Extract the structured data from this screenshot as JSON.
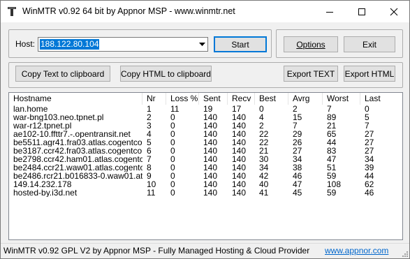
{
  "window": {
    "title": "WinMTR v0.92 64 bit by Appnor MSP - www.winmtr.net",
    "icon": "pliers-icon"
  },
  "host": {
    "label": "Host:",
    "value": "188.122.80.104",
    "start_label": "Start"
  },
  "options": {
    "options_label": "Options",
    "exit_label": "Exit"
  },
  "export": {
    "copy_text_label": "Copy Text to clipboard",
    "copy_html_label": "Copy HTML to clipboard",
    "export_text_label": "Export TEXT",
    "export_html_label": "Export HTML"
  },
  "table": {
    "columns": [
      "Hostname",
      "Nr",
      "Loss %",
      "Sent",
      "Recv",
      "Best",
      "Avrg",
      "Worst",
      "Last"
    ],
    "rows": [
      [
        "lan.home",
        "1",
        "11",
        "19",
        "17",
        "0",
        "2",
        "7",
        "0"
      ],
      [
        "war-bng103.neo.tpnet.pl",
        "2",
        "0",
        "140",
        "140",
        "4",
        "15",
        "89",
        "5"
      ],
      [
        "war-r12.tpnet.pl",
        "3",
        "0",
        "140",
        "140",
        "2",
        "7",
        "21",
        "7"
      ],
      [
        "ae102-10.ffttr7.-.opentransit.net",
        "4",
        "0",
        "140",
        "140",
        "22",
        "29",
        "65",
        "27"
      ],
      [
        "be5511.agr41.fra03.atlas.cogentco.c...",
        "5",
        "0",
        "140",
        "140",
        "22",
        "26",
        "44",
        "27"
      ],
      [
        "be3187.ccr42.fra03.atlas.cogentco.c...",
        "6",
        "0",
        "140",
        "140",
        "21",
        "27",
        "83",
        "27"
      ],
      [
        "be2798.ccr42.ham01.atlas.cogentco....",
        "7",
        "0",
        "140",
        "140",
        "30",
        "34",
        "47",
        "34"
      ],
      [
        "be2484.ccr21.waw01.atlas.cogentc...",
        "8",
        "0",
        "140",
        "140",
        "34",
        "38",
        "51",
        "39"
      ],
      [
        "be2486.rcr21.b016833-0.waw01.atla...",
        "9",
        "0",
        "140",
        "140",
        "42",
        "46",
        "59",
        "44"
      ],
      [
        "149.14.232.178",
        "10",
        "0",
        "140",
        "140",
        "40",
        "47",
        "108",
        "62"
      ],
      [
        "hosted-by.i3d.net",
        "11",
        "0",
        "140",
        "140",
        "41",
        "45",
        "59",
        "46"
      ]
    ]
  },
  "status": {
    "text": "WinMTR v0.92 GPL V2 by Appnor MSP - Fully Managed Hosting & Cloud Provider",
    "link": "www.appnor.com"
  },
  "colors": {
    "selection": "#0078d7",
    "link": "#0066cc",
    "button_face": "#e1e1e1"
  }
}
